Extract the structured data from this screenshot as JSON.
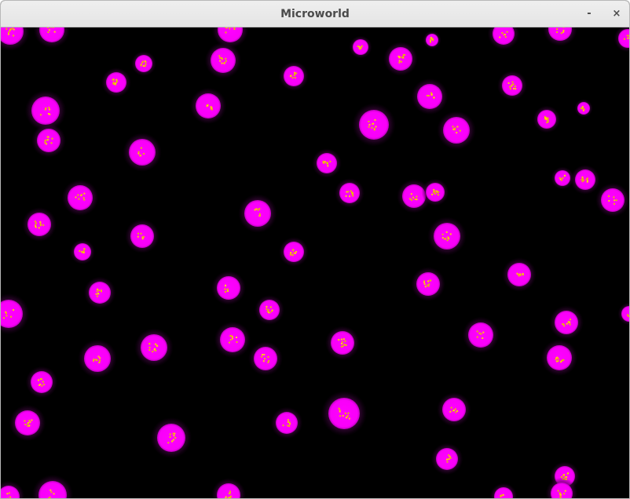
{
  "window": {
    "title": "Microworld",
    "minimize_glyph": "-",
    "close_glyph": "×"
  },
  "colors": {
    "background": "#000000",
    "cell_glow": "#5a0a5a",
    "cell_body": "#ff00ff",
    "nucleus": "#f0c000",
    "titlebar": "#e8e8e8",
    "title_text": "#4b4b4b"
  }
}
